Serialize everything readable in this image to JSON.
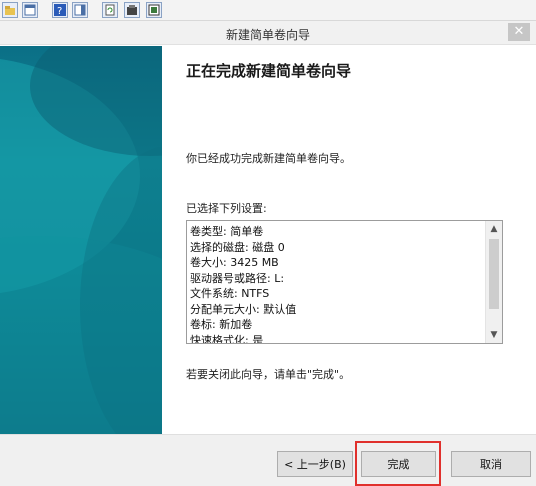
{
  "window": {
    "title": "新建简单卷向导",
    "close_glyph": "✕"
  },
  "content": {
    "heading": "正在完成新建简单卷向导",
    "success_message": "你已经成功完成新建简单卷向导。",
    "settings_label": "已选择下列设置:",
    "settings": [
      "卷类型: 简单卷",
      "选择的磁盘: 磁盘 0",
      "卷大小: 3425 MB",
      "驱动器号或路径: L:",
      "文件系统: NTFS",
      "分配单元大小: 默认值",
      "卷标: 新加卷",
      "快速格式化: 是"
    ],
    "close_hint": "若要关闭此向导，请单击\"完成\"。"
  },
  "buttons": {
    "back": "< 上一步(B)",
    "finish": "完成",
    "cancel": "取消"
  },
  "scrollbar": {
    "up_glyph": "▲",
    "down_glyph": "▼"
  },
  "colors": {
    "side_panel": "#0f8a99",
    "highlight": "#e0302c"
  }
}
